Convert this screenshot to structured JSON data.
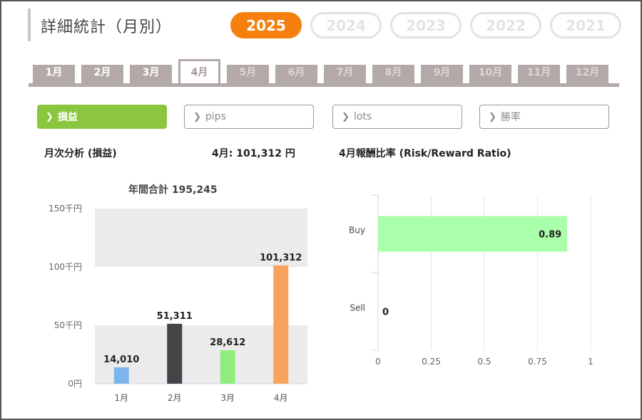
{
  "header": {
    "title": "詳細統計（月別）",
    "years": [
      "2025",
      "2024",
      "2023",
      "2022",
      "2021"
    ],
    "active_year": "2025"
  },
  "months": [
    "1月",
    "2月",
    "3月",
    "4月",
    "5月",
    "6月",
    "7月",
    "8月",
    "9月",
    "10月",
    "11月",
    "12月"
  ],
  "active_month": "4月",
  "metrics": [
    {
      "label": "損益",
      "active": true
    },
    {
      "label": "pips",
      "active": false
    },
    {
      "label": "lots",
      "active": false
    },
    {
      "label": "勝率",
      "active": false
    }
  ],
  "summary": {
    "left_title": "月次分析 (損益)",
    "month_value": "4月:  101,312 円",
    "right_title": "4月報酬比率 (Risk/Reward Ratio)",
    "annual_total": "年間合計 195,245"
  },
  "colors": {
    "accent": "#f5800d",
    "metric_active": "#8cc63f",
    "tab": "#b3a9a9"
  },
  "chart_data": [
    {
      "type": "bar",
      "categories": [
        "1月",
        "2月",
        "3月",
        "4月"
      ],
      "values": [
        14010,
        51311,
        28612,
        101312
      ],
      "value_labels": [
        "14,010",
        "51,311",
        "28,612",
        "101,312"
      ],
      "bar_colors": [
        "#7cb5ec",
        "#434348",
        "#90ed7d",
        "#f7a35c"
      ],
      "ylim": [
        0,
        150000
      ],
      "yticks": [
        0,
        50000,
        100000,
        150000
      ],
      "ytick_labels": [
        "0円",
        "50千円",
        "100千円",
        "150千円"
      ],
      "grid": "alternating bands"
    },
    {
      "type": "bar",
      "orientation": "horizontal",
      "categories": [
        "Buy",
        "Sell"
      ],
      "values": [
        0.89,
        0
      ],
      "value_labels": [
        "0.89",
        "0"
      ],
      "bar_color": "#aaffaa",
      "xlim": [
        0,
        1
      ],
      "xticks": [
        0,
        0.25,
        0.5,
        0.75,
        1
      ],
      "xtick_labels": [
        "0",
        "0.25",
        "0.5",
        "0.75",
        "1"
      ],
      "grid": true
    }
  ]
}
